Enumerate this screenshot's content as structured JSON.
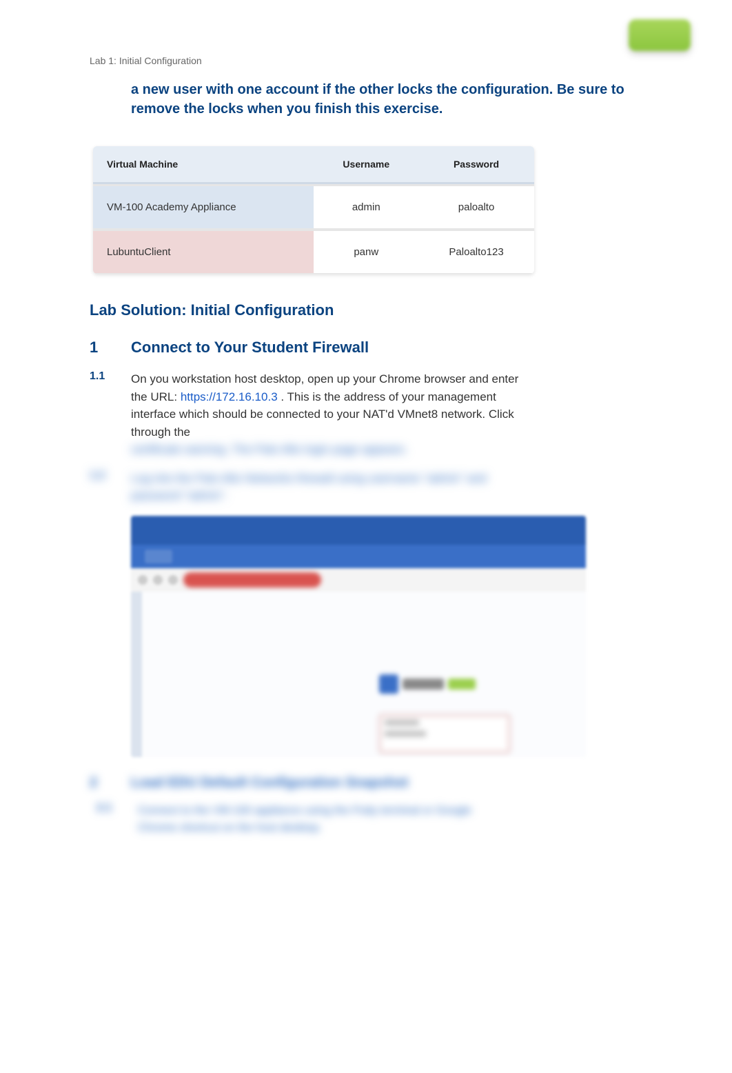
{
  "topButton": {
    "label": ""
  },
  "labTitle": "Lab 1: Initial Configuration",
  "intro": "a new user with one account if the other locks the configuration. Be sure to remove the locks when you finish this exercise.",
  "table": {
    "headers": [
      "Virtual Machine",
      "Username",
      "Password"
    ],
    "rows": [
      {
        "vm": "VM-100 Academy Appliance",
        "user": "admin",
        "pass": "paloalto",
        "tint": "blue"
      },
      {
        "vm": "LubuntuClient",
        "user": "panw",
        "pass": "Paloalto123",
        "tint": "red"
      }
    ]
  },
  "solutionHeading": "Lab Solution:  Initial Configuration",
  "section1": {
    "num": "1",
    "title": "Connect to Your Student Firewall"
  },
  "step11": {
    "num": "1.1",
    "preUrl": "On you workstation host desktop, open up your Chrome browser and enter the URL: ",
    "url": "https://172.16.10.3",
    "postUrl": " . This is the address of your management interface which should be connected to your NAT'd VMnet8 network.  Click through the",
    "blurredTail": "certificate warning. The Palo Alto login page appears."
  },
  "step12": {
    "num": "1.2",
    "blurredText": "Log into the Palo Alto Networks firewall using username \"admin\" and password \"admin\"."
  },
  "blurSection": {
    "num": "2",
    "title": "Load EDU Default Configuration Snapshot",
    "stepNum": "2.1",
    "stepText": "Connect to the VM-100 appliance using the Putty terminal or Google Chrome shortcut on the host desktop."
  }
}
